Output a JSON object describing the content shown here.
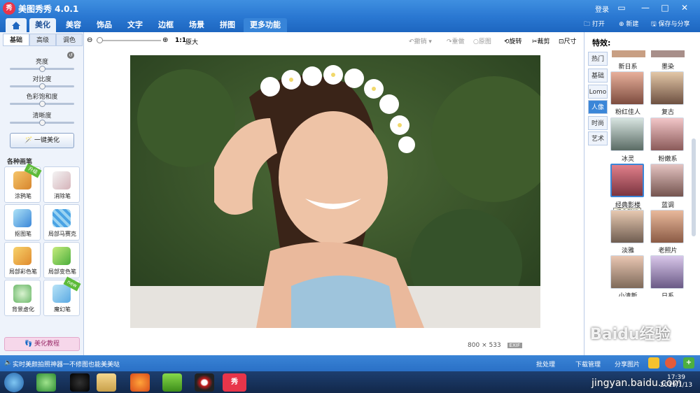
{
  "title": {
    "app_logo": "秀",
    "text": "美图秀秀 4.0.1",
    "login": "登录",
    "min_icon": "—",
    "max_icon": "□",
    "close_icon": "✕",
    "restore_icon": "▭"
  },
  "menu": {
    "tabs": [
      "美化",
      "美容",
      "饰品",
      "文字",
      "边框",
      "场景",
      "拼图"
    ],
    "more": "更多功能",
    "open": "打开",
    "new": "新建",
    "save": "保存与分享"
  },
  "left": {
    "tabs": [
      "基础",
      "高级",
      "调色"
    ],
    "sliders": [
      "亮度",
      "对比度",
      "色彩饱和度",
      "清晰度"
    ],
    "slider_values": [
      0.5,
      0.5,
      0.5,
      0.5
    ],
    "beautify": "一键美化",
    "brush_title": "各种画笔",
    "tools": [
      {
        "label": "涂鸦笔",
        "badge": "升级"
      },
      {
        "label": "消除笔",
        "badge": ""
      },
      {
        "label": "抠图笔",
        "badge": ""
      },
      {
        "label": "局部马赛克",
        "badge": ""
      },
      {
        "label": "局部彩色笔",
        "badge": ""
      },
      {
        "label": "局部变色笔",
        "badge": ""
      },
      {
        "label": "背景虚化",
        "badge": ""
      },
      {
        "label": "魔幻笔",
        "badge": "new"
      }
    ],
    "tutorial": "美化教程"
  },
  "toolbar": {
    "zoom_ratio": "1:1",
    "original": "原大",
    "undo": "撤销",
    "redo": "重做",
    "origin": "原图",
    "rotate": "旋转",
    "crop": "裁剪",
    "size": "尺寸"
  },
  "image": {
    "width": "800",
    "x": "×",
    "height": "533",
    "exif": "EXIF"
  },
  "right": {
    "title": "特效:",
    "tabs": [
      "热门",
      "基础",
      "Lomo",
      "人像",
      "时尚",
      "艺术"
    ],
    "active_tab": "人像",
    "effects": [
      "新日系",
      "墨染",
      "粉红佳人",
      "复古",
      "冰灵",
      "粉嫩系",
      "经典影楼",
      "蓝调",
      "淡雅",
      "老照片",
      "小清新",
      "日系"
    ],
    "tooltip": "经典影楼"
  },
  "bottom": {
    "tip": "实时美颜拍照神器一不修图也能美美哒",
    "batch": "批处理",
    "download": "下载管理",
    "share": "分享图片"
  },
  "taskbar": {
    "time": "17:39",
    "date": "2019/1/13",
    "icon_label": "秀"
  },
  "watermark": {
    "text": "Baidu经验",
    "url": "jingyan.baidu.com"
  }
}
